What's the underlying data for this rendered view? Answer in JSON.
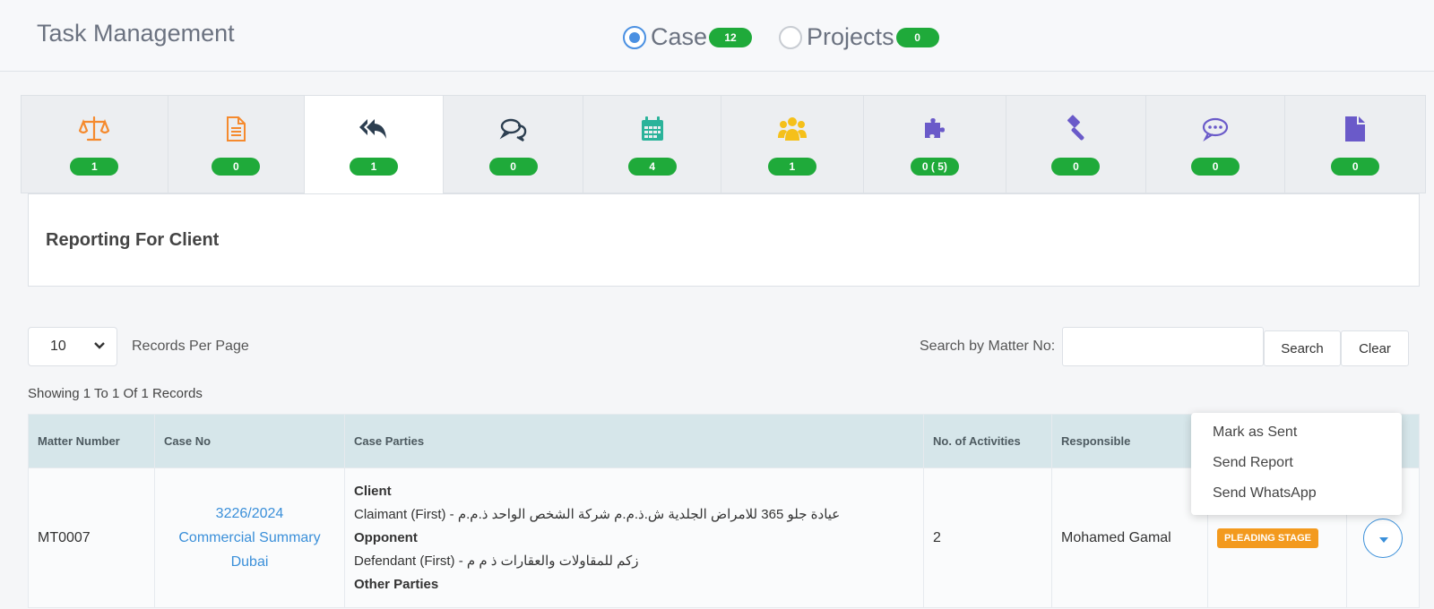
{
  "header": {
    "title": "Task Management",
    "radios": [
      {
        "label": "Case",
        "count": "12",
        "checked": true
      },
      {
        "label": "Projects",
        "count": "0",
        "checked": false
      }
    ]
  },
  "tabs": [
    {
      "icon": "scales-icon",
      "count": "1",
      "color": "#f58a2e"
    },
    {
      "icon": "document-icon",
      "count": "0",
      "color": "#f58a2e"
    },
    {
      "icon": "reply-all-icon",
      "count": "1",
      "color": "#2c3e50",
      "active": true
    },
    {
      "icon": "comments-icon",
      "count": "0",
      "color": "#2c3e50"
    },
    {
      "icon": "calendar-icon",
      "count": "4",
      "color": "#2bb39a"
    },
    {
      "icon": "users-icon",
      "count": "1",
      "color": "#f5c01a"
    },
    {
      "icon": "puzzle-icon",
      "count": "0 ( 5)",
      "color": "#6a5ac9"
    },
    {
      "icon": "gavel-icon",
      "count": "0",
      "color": "#6a5ac9"
    },
    {
      "icon": "chat-bubble-icon",
      "count": "0",
      "color": "#6a5ac9"
    },
    {
      "icon": "file-icon",
      "count": "0",
      "color": "#6a5ac9"
    }
  ],
  "panel": {
    "title": "Reporting For Client"
  },
  "controls": {
    "per_page_value": "10",
    "per_page_label": "Records Per Page",
    "search_label": "Search by Matter No:",
    "search_value": "",
    "search_button": "Search",
    "clear_button": "Clear",
    "showing": "Showing 1 To 1 Of 1 Records"
  },
  "table": {
    "headers": [
      "Matter Number",
      "Case No",
      "Case Parties",
      "No. of Activities",
      "Responsible",
      "",
      ""
    ],
    "row": {
      "matter": "MT0007",
      "case_no": [
        "3226/2024",
        "Commercial Summary",
        "Dubai"
      ],
      "client_heading": "Client",
      "client_line": "Claimant (First) - عيادة جلو 365 للامراض الجلدية ش.ذ.م.م شركة الشخص الواحد ذ.م.م",
      "opponent_heading": "Opponent",
      "opponent_line": "Defendant (First) - زكم للمقاولات والعقارات ذ م م",
      "other_heading": "Other Parties",
      "activities": "2",
      "responsible": "Mohamed Gamal",
      "stage": "PLEADING STAGE"
    }
  },
  "dropdown": {
    "items": [
      "Mark as Sent",
      "Send Report",
      "Send WhatsApp"
    ]
  }
}
